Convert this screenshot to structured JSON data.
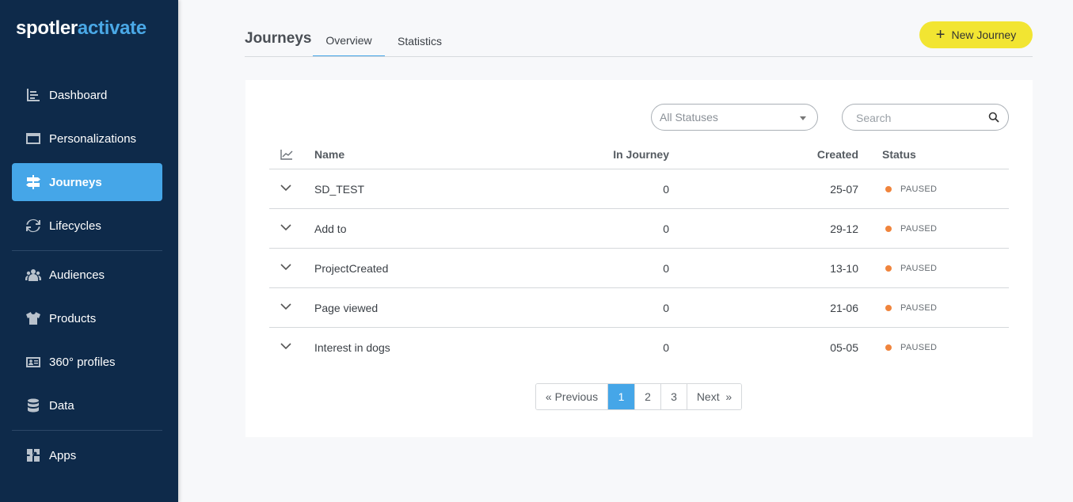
{
  "brand": {
    "part1": "spotler",
    "part2": "activate"
  },
  "sidebar": {
    "items": [
      {
        "label": "Dashboard",
        "icon": "dashboard-icon"
      },
      {
        "label": "Personalizations",
        "icon": "browser-window-icon"
      },
      {
        "label": "Journeys",
        "icon": "signpost-icon",
        "active": true
      },
      {
        "label": "Lifecycles",
        "icon": "refresh-cycle-icon"
      },
      {
        "label": "Audiences",
        "icon": "users-icon"
      },
      {
        "label": "Products",
        "icon": "tshirt-icon"
      },
      {
        "label": "360° profiles",
        "icon": "id-card-icon"
      },
      {
        "label": "Data",
        "icon": "database-icon"
      },
      {
        "label": "Apps",
        "icon": "puzzle-icon"
      }
    ]
  },
  "header": {
    "title": "Journeys",
    "tabs": [
      {
        "label": "Overview",
        "active": true
      },
      {
        "label": "Statistics",
        "active": false
      }
    ],
    "new_button": "New Journey"
  },
  "filters": {
    "status_selected": "All Statuses",
    "search_placeholder": "Search"
  },
  "table": {
    "columns": {
      "name": "Name",
      "in_journey": "In Journey",
      "created": "Created",
      "status": "Status"
    },
    "rows": [
      {
        "name": "SD_TEST",
        "in_journey": "0",
        "created": "25-07",
        "status": "PAUSED"
      },
      {
        "name": "Add to",
        "in_journey": "0",
        "created": "29-12",
        "status": "PAUSED"
      },
      {
        "name": "ProjectCreated",
        "in_journey": "0",
        "created": "13-10",
        "status": "PAUSED"
      },
      {
        "name": "Page viewed",
        "in_journey": "0",
        "created": "21-06",
        "status": "PAUSED"
      },
      {
        "name": "Interest in dogs",
        "in_journey": "0",
        "created": "05-05",
        "status": "PAUSED"
      }
    ]
  },
  "pagination": {
    "previous": "« Previous",
    "pages": [
      "1",
      "2",
      "3"
    ],
    "current": "1",
    "next": "Next  »"
  },
  "colors": {
    "sidebar_bg": "#0e2a4a",
    "accent": "#45a6e8",
    "new_button": "#f2e532",
    "status_paused": "#f0843c"
  }
}
